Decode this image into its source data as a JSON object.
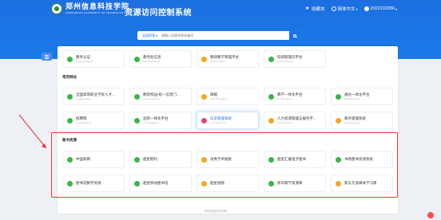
{
  "header": {
    "logo_cn": "郑州信息科技学院",
    "logo_en": "ZHENGZHOU UNIVERSITY OF TECHNOLOGY",
    "title": "资源访问控制系统",
    "favorites": "收藏夹",
    "language": "简体中文",
    "user": "2022102956"
  },
  "search": {
    "category": "全部资源",
    "placeholder": "请输入资源名称关键词"
  },
  "sections": [
    {
      "title": "",
      "items": [
        {
          "name": "教务认证",
          "url": "jwc.zzuit.edu.cn",
          "icon": "green-circle-icon",
          "color": "#3bb54a"
        },
        {
          "name": "教务处信息",
          "url": "jwc.zzuit.edu.cn",
          "icon": "green-circle-icon",
          "color": "#3bb54a"
        },
        {
          "name": "教研教学管理平台",
          "url": "jw.zzuit.edu.cn",
          "icon": "orange-circle-icon",
          "color": "#f5a623"
        },
        {
          "name": "科研管理云平台",
          "url": "ky.zzuit.edu.cn",
          "icon": "green-circle-icon",
          "color": "#3bb54a"
        }
      ]
    },
    {
      "title": "常用网站",
      "items": [
        {
          "name": "全国高等职业学校人才...",
          "url": "rc.zzuit.edu.cn",
          "icon": "green-circle-icon",
          "color": "#3bb54a"
        },
        {
          "name": "数智校园-统一信息门...",
          "url": "my.zzuit.edu.cn",
          "icon": "green-circle-icon",
          "color": "#3bb54a"
        },
        {
          "name": "邮箱",
          "url": "mail.zzuit.edu.cn",
          "icon": "orange-circle-icon",
          "color": "#f5a623"
        },
        {
          "name": "教学一体化平台",
          "url": "jx.zzuit.edu.cn",
          "icon": "green-circle-icon",
          "color": "#3bb54a"
        },
        {
          "name": "通达一体化平台",
          "url": "td.zzuit.edu.cn",
          "icon": "green-circle-icon",
          "color": "#3bb54a"
        },
        {
          "name": "招聘网",
          "url": "zp.zzuit.edu.cn",
          "icon": "green-circle-icon",
          "color": "#3bb54a"
        },
        {
          "name": "迎新一体化平台",
          "url": "yx.zzuit.edu.cn",
          "icon": "green-circle-icon",
          "color": "#3bb54a"
        },
        {
          "name": "信息管理系统",
          "url": "xx.zzuit.edu.cn",
          "icon": "pink-circle-icon",
          "color": "#e8457c",
          "active": true
        },
        {
          "name": "人力资源管理与服务平...",
          "url": "rs.zzuit.edu.cn",
          "icon": "orange-circle-icon",
          "color": "#f5a623"
        },
        {
          "name": "教务管理系统",
          "url": "jw.zzuit.edu.cn",
          "icon": "orange-circle-icon",
          "color": "#f5a623"
        }
      ]
    },
    {
      "title": "图书资源",
      "items": [
        {
          "name": "中国知网",
          "icon": "green-circle-icon",
          "color": "#3bb54a"
        },
        {
          "name": "超星期刊",
          "icon": "green-circle-icon",
          "color": "#3bb54a"
        },
        {
          "name": "读秀学术搜索",
          "icon": "orange-circle-icon",
          "color": "#f5a623"
        },
        {
          "name": "超星汇雅电子图书",
          "icon": "green-circle-icon",
          "color": "#3bb54a"
        },
        {
          "name": "书香图书资源系统",
          "icon": "green-circle-icon",
          "color": "#3bb54a"
        },
        {
          "name": "图书馆数字资源",
          "icon": "green-circle-icon",
          "color": "#3bb54a"
        },
        {
          "name": "超星移动图书馆",
          "icon": "green-circle-icon",
          "color": "#3bb54a"
        },
        {
          "name": "超星视频",
          "icon": "orange-circle-icon",
          "color": "#f5a623"
        },
        {
          "name": "新华教学资源库",
          "icon": "green-circle-icon",
          "color": "#3bb54a"
        },
        {
          "name": "新东方多媒体学习库",
          "icon": "orange-circle-icon",
          "color": "#f5a623"
        }
      ]
    }
  ],
  "footer": "郑州信息科技学院",
  "colors": {
    "header_blue": "#1a73e8",
    "highlight_red": "#e53935"
  }
}
